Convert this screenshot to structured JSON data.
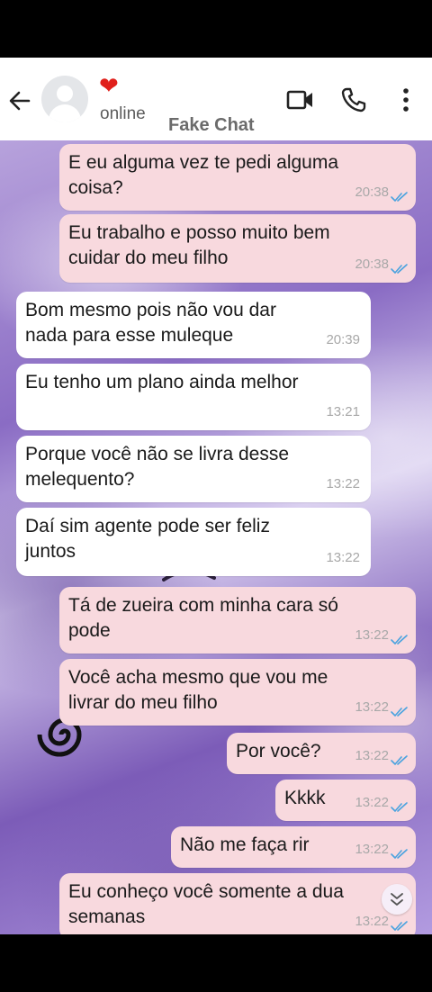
{
  "contact": {
    "status": "online",
    "title": "Fake Chat",
    "emoji": "❤"
  },
  "messages": [
    {
      "text": "E eu alguma vez te pedi alguma\ncoisa?",
      "time": "20:38",
      "direction": "out",
      "read": true
    },
    {
      "text": "Eu trabalho e posso muito bem\ncuidar do meu filho",
      "time": "20:38",
      "direction": "out",
      "read": true
    },
    {
      "text": "Bom mesmo pois não vou dar\nnada para esse muleque",
      "time": "20:39",
      "direction": "in"
    },
    {
      "text": "Eu tenho um plano ainda melhor",
      "time": "13:21",
      "direction": "in"
    },
    {
      "text": "Porque você não se livra desse\nmelequento?",
      "time": "13:22",
      "direction": "in"
    },
    {
      "text": "Daí sim agente pode ser feliz\njuntos",
      "time": "13:22",
      "direction": "in"
    },
    {
      "text": "Tá de zueira com minha cara só\npode",
      "time": "13:22",
      "direction": "out",
      "read": true
    },
    {
      "text": "Você acha mesmo que vou me\nlivrar do meu filho",
      "time": "13:22",
      "direction": "out",
      "read": true
    },
    {
      "text": "Por você?",
      "time": "13:22",
      "direction": "out",
      "read": true
    },
    {
      "text": "Kkkk",
      "time": "13:22",
      "direction": "out",
      "read": true
    },
    {
      "text": "Não me faça rir",
      "time": "13:22",
      "direction": "out",
      "read": true
    },
    {
      "text": "Eu conheço você somente a dua\nsemanas",
      "time": "13:22",
      "direction": "out",
      "read": true
    }
  ],
  "colors": {
    "outgoing_bubble": "#f8d9de",
    "incoming_bubble": "#ffffff",
    "read_ticks": "#4aa3df"
  },
  "icons": [
    "back-arrow-icon",
    "video-call-icon",
    "phone-icon",
    "more-vert-icon",
    "double-check-icon",
    "scroll-down-icon"
  ]
}
